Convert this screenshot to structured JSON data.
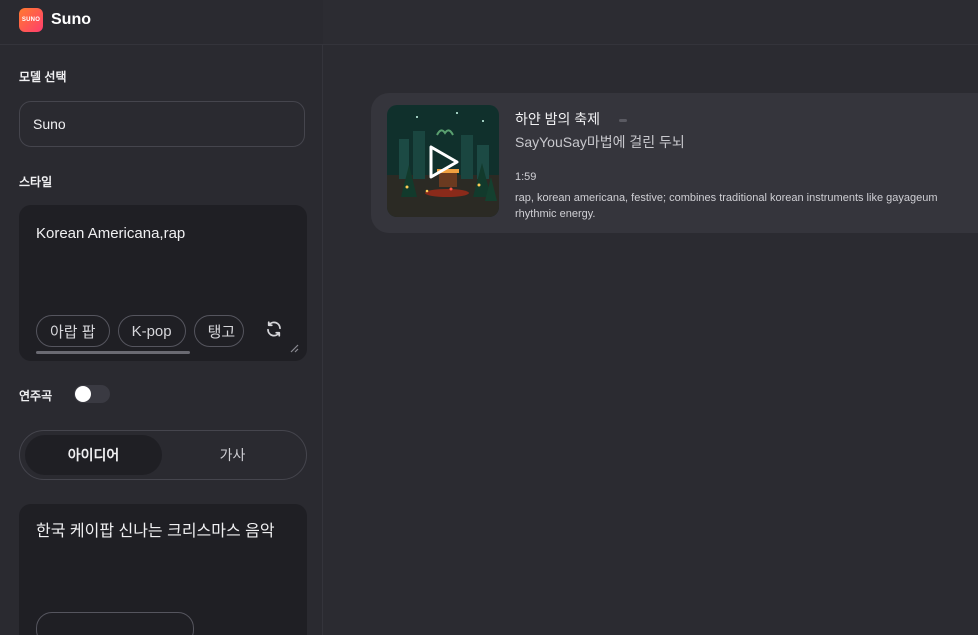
{
  "app": {
    "brand": "Suno",
    "logo_text": "SUNO"
  },
  "sidebar": {
    "model_label": "모델 선택",
    "model_value": "Suno",
    "style_label": "스타일",
    "style_value": "Korean Americana,rap",
    "style_chips": [
      "아랍 팝",
      "K-pop",
      "탱고"
    ],
    "instrumental_label": "연주곡",
    "instrumental_on": false,
    "mode_tabs": [
      "아이디어",
      "가사"
    ],
    "mode_selected": "아이디어",
    "idea_text": "한국 케이팝 신나는 크리스마스 음악"
  },
  "track": {
    "title": "하얀 밤의 축제",
    "artist": "SayYouSay마법에 걸린 두뇌",
    "duration": "1:59",
    "description": "rap, korean americana, festive; combines traditional korean instruments like gayageum",
    "description_line2": "rhythmic energy."
  },
  "colors": {
    "accent_gradient": [
      "#ff7a2f",
      "#ff3d6e"
    ],
    "card_bg": "#35353c"
  }
}
